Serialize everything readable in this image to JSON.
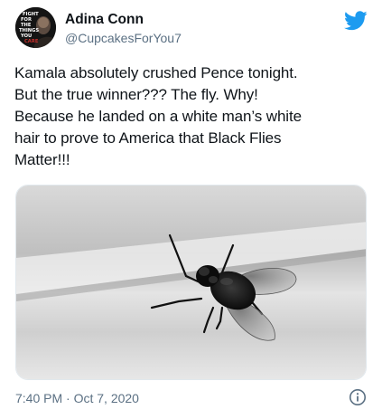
{
  "tweet": {
    "display_name": "Adina Conn",
    "handle": "@CupcakesForYou7",
    "text_lines": [
      "Kamala absolutely crushed Pence tonight.",
      "But the true winner??? The fly. Why!",
      "Because he landed on a white man’s white",
      "hair to prove to America that Black Flies",
      "Matter!!!"
    ],
    "time": "7:40 PM",
    "separator": " · ",
    "date": "Oct 7, 2020",
    "media": {
      "content": "black-and-white photo of a fly"
    }
  },
  "avatar": {
    "lettering": [
      "FIGHT",
      "FOR",
      "THE",
      "THINGS",
      "YOU",
      "CARE"
    ]
  },
  "icons": {
    "brand": "twitter-bird-icon",
    "info": "info-icon"
  },
  "colors": {
    "twitter_blue": "#1d9bf0",
    "secondary_text": "#5b7083",
    "primary_text": "#0f1419"
  }
}
